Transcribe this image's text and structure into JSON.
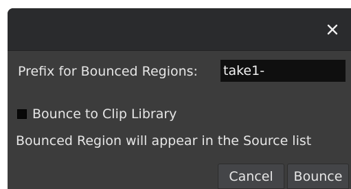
{
  "dialog": {
    "close_icon": "close-icon",
    "prefix_label": "Prefix for Bounced Regions:",
    "prefix_value": "take1-",
    "checkbox_label": "Bounce to Clip Library",
    "checkbox_checked": false,
    "info_text": "Bounced Region will appear in the Source list",
    "cancel_label": "Cancel",
    "bounce_label": "Bounce"
  },
  "colors": {
    "titlebar": "#2a2b2d",
    "body": "#3c3c3c",
    "input_bg": "#0f0f0f",
    "text": "#e6e6e6",
    "button_bg": "#444548"
  }
}
